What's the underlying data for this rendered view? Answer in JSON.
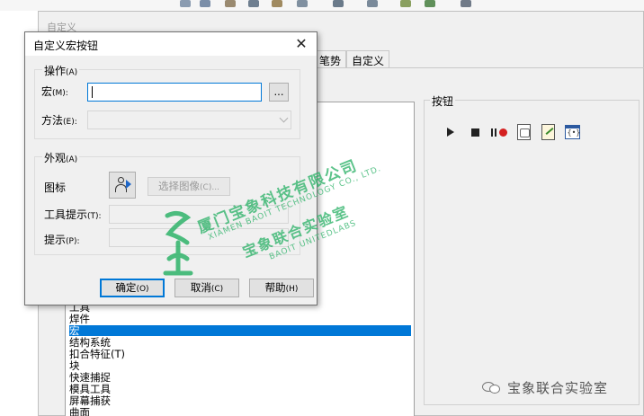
{
  "background_window": {
    "title": "自定义",
    "tabs": [
      "笔势",
      "自定义"
    ],
    "categories": [
      "工具",
      "焊件",
      "宏",
      "结构系统",
      "扣合特征(T)",
      "块",
      "快速捕捉",
      "模具工具",
      "屏幕捕获",
      "曲面"
    ],
    "selected_category": "宏",
    "buttons_group_label": "按钮",
    "macro_buttons": [
      "play-icon",
      "stop-icon",
      "pause-record-icon",
      "new-macro-icon",
      "edit-macro-icon",
      "custom-macro-icon"
    ]
  },
  "dialog": {
    "title": "自定义宏按钮",
    "close_symbol": "✕",
    "action_group": {
      "label": "操作",
      "label_key": "(A)",
      "macro_label": "宏",
      "macro_key": "(M):",
      "macro_value": "",
      "browse_button": "...",
      "method_label": "方法",
      "method_key": "(E):",
      "method_value": ""
    },
    "appearance_group": {
      "label": "外观",
      "label_key": "(A)",
      "icon_label": "图标",
      "select_image_button": "选择图像",
      "select_image_key": "(C)...",
      "tooltip_label": "工具提示",
      "tooltip_key": "(T):",
      "tooltip_value": "",
      "prompt_label": "提示",
      "prompt_key": "(P):",
      "prompt_value": ""
    },
    "ok_button": "确定",
    "ok_key": "(O)",
    "cancel_button": "取消",
    "cancel_key": "(C)",
    "help_button": "帮助",
    "help_key": "(H)"
  },
  "watermark": {
    "line1": "厦门宝象科技有限公司",
    "line2": "XIAMEN BAOIT TECHNOLOGY CO., LTD.",
    "line3": "宝象联合实验室",
    "line4": "BAOIT UNITEDLABS"
  },
  "brand": {
    "text": "宝象联合实验室",
    "icon": "wechat-icon"
  },
  "colors": {
    "selection": "#0078d7",
    "watermark": "#2fb36a",
    "record": "#d42020"
  }
}
